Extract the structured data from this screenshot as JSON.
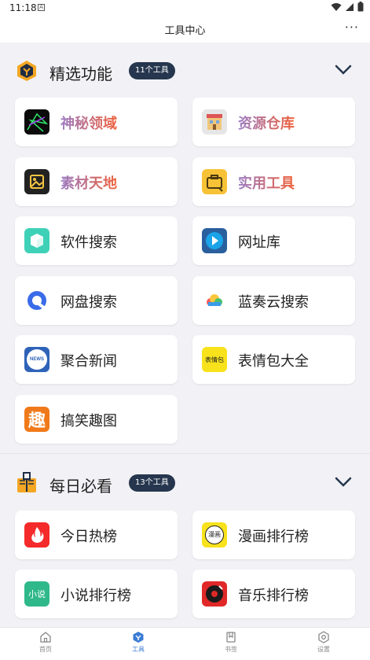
{
  "status": {
    "time": "11:18",
    "badge": "A"
  },
  "header": {
    "title": "工具中心",
    "more": "···"
  },
  "sections": [
    {
      "title": "精选功能",
      "count": "11个工具",
      "items": [
        {
          "label": "神秘领域",
          "icon": "mystery-icon",
          "highlight": true
        },
        {
          "label": "资源仓库",
          "icon": "warehouse-icon",
          "highlight": true
        },
        {
          "label": "素材天地",
          "icon": "image-icon",
          "highlight": true
        },
        {
          "label": "实用工具",
          "icon": "toolbox-icon",
          "highlight": true
        },
        {
          "label": "软件搜索",
          "icon": "cube-icon"
        },
        {
          "label": "网址库",
          "icon": "link-icon"
        },
        {
          "label": "网盘搜索",
          "icon": "cloud-disk-icon"
        },
        {
          "label": "蓝奏云搜索",
          "icon": "cloud-icon"
        },
        {
          "label": "聚合新闻",
          "icon": "news-icon",
          "icon_text": "NEWS"
        },
        {
          "label": "表情包大全",
          "icon": "emoji-pack-icon",
          "icon_text": "表情包"
        },
        {
          "label": "搞笑趣图",
          "icon": "funny-icon",
          "icon_text": "趣"
        }
      ]
    },
    {
      "title": "每日必看",
      "count": "13个工具",
      "items": [
        {
          "label": "今日热榜",
          "icon": "flame-icon"
        },
        {
          "label": "漫画排行榜",
          "icon": "comic-icon",
          "icon_text": "漫画"
        },
        {
          "label": "小说排行榜",
          "icon": "novel-icon",
          "icon_text": "小说"
        },
        {
          "label": "音乐排行榜",
          "icon": "record-icon"
        }
      ]
    }
  ],
  "nav": [
    {
      "label": "首页",
      "icon": "home-icon"
    },
    {
      "label": "工具",
      "icon": "tools-icon",
      "active": true
    },
    {
      "label": "书签",
      "icon": "bookmark-icon"
    },
    {
      "label": "设置",
      "icon": "settings-icon"
    }
  ],
  "colors": {
    "accent": "#26364e",
    "active": "#3a7bd5",
    "highlight_from": "#9b7cc4",
    "highlight_to": "#f0603a"
  }
}
